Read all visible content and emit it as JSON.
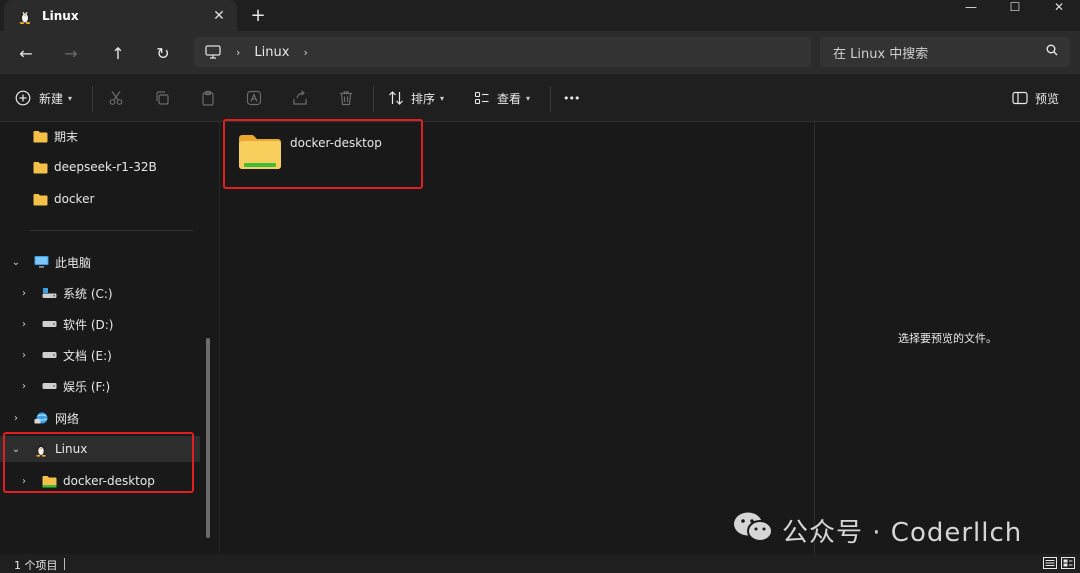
{
  "tab": {
    "title": "Linux",
    "close": "✕"
  },
  "new_tab": "+",
  "window_controls": {
    "minimize": "—",
    "maximize": "☐",
    "close": "✕"
  },
  "nav": {
    "back": "←",
    "forward": "→",
    "up": "↑",
    "refresh": "↻"
  },
  "breadcrumb": {
    "sep1": "›",
    "item1": "Linux",
    "sep2": "›"
  },
  "search": {
    "placeholder": "在 Linux 中搜索"
  },
  "toolbar": {
    "new_label": "新建",
    "sort_label": "排序",
    "view_label": "查看",
    "more_label": "•••",
    "preview_label": "预览"
  },
  "sidebar": {
    "quick_items": [
      {
        "label": "期末"
      },
      {
        "label": "deepseek-r1-32B"
      },
      {
        "label": "docker"
      }
    ],
    "this_pc": "此电脑",
    "drives": [
      {
        "label": "系统 (C:)"
      },
      {
        "label": "软件 (D:)"
      },
      {
        "label": "文档 (E:)"
      },
      {
        "label": "娱乐 (F:)"
      }
    ],
    "network": "网络",
    "linux": "Linux",
    "linux_child": "docker-desktop"
  },
  "content": {
    "items": [
      {
        "name": "docker-desktop"
      }
    ]
  },
  "preview": {
    "empty_text": "选择要预览的文件。"
  },
  "status": {
    "count": "1 个项目"
  },
  "watermark": {
    "text": "公众号 · Coderllch"
  },
  "colors": {
    "accent_folder": "#f4c04a",
    "folder_green": "#3bbf3b",
    "highlight": "#e02020"
  }
}
